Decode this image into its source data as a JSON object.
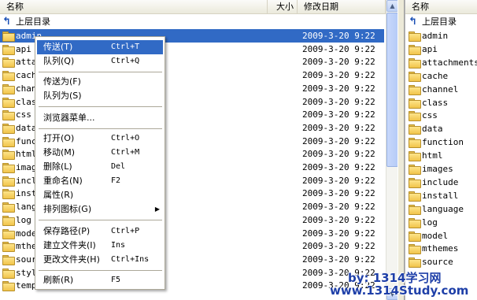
{
  "left": {
    "headers": {
      "name": "名称",
      "size": "大小",
      "modified": "修改日期"
    },
    "up_label": "上层目录",
    "rows": [
      {
        "name": "admin",
        "date": "2009-3-20  9:22"
      },
      {
        "name": "api",
        "date": "2009-3-20  9:22"
      },
      {
        "name": "attachments",
        "date": "2009-3-20  9:22"
      },
      {
        "name": "cache",
        "date": "2009-3-20  9:22"
      },
      {
        "name": "channel",
        "date": "2009-3-20  9:22"
      },
      {
        "name": "class",
        "date": "2009-3-20  9:22"
      },
      {
        "name": "css",
        "date": "2009-3-20  9:22"
      },
      {
        "name": "data",
        "date": "2009-3-20  9:22"
      },
      {
        "name": "function",
        "date": "2009-3-20  9:22"
      },
      {
        "name": "html",
        "date": "2009-3-20  9:22"
      },
      {
        "name": "images",
        "date": "2009-3-20  9:22"
      },
      {
        "name": "include",
        "date": "2009-3-20  9:22"
      },
      {
        "name": "install",
        "date": "2009-3-20  9:22"
      },
      {
        "name": "language",
        "date": "2009-3-20  9:22"
      },
      {
        "name": "log",
        "date": "2009-3-20  9:22"
      },
      {
        "name": "model",
        "date": "2009-3-20  9:22"
      },
      {
        "name": "mthemes",
        "date": "2009-3-20  9:22"
      },
      {
        "name": "source",
        "date": "2009-3-20  9:22"
      },
      {
        "name": "style",
        "date": "2009-3-20  9:22"
      },
      {
        "name": "templates",
        "date": "2009-3-20  9:22"
      }
    ]
  },
  "right": {
    "headers": {
      "name": "名称"
    },
    "up_label": "上层目录",
    "rows": [
      "admin",
      "api",
      "attachments",
      "cache",
      "channel",
      "class",
      "css",
      "data",
      "function",
      "html",
      "images",
      "include",
      "install",
      "language",
      "log",
      "model",
      "mthemes",
      "source"
    ]
  },
  "menu": {
    "transfer": {
      "label": "传送(T)",
      "shortcut": "Ctrl+T"
    },
    "queue": {
      "label": "队列(Q)",
      "shortcut": "Ctrl+Q"
    },
    "transfer_as": {
      "label": "传送为(F)"
    },
    "queue_as": {
      "label": "队列为(S)"
    },
    "browser_menu": {
      "label": "浏览器菜单..."
    },
    "open": {
      "label": "打开(O)",
      "shortcut": "Ctrl+O"
    },
    "move": {
      "label": "移动(M)",
      "shortcut": "Ctrl+M"
    },
    "delete": {
      "label": "删除(L)",
      "shortcut": "Del"
    },
    "rename": {
      "label": "重命名(N)",
      "shortcut": "F2"
    },
    "properties": {
      "label": "属性(R)"
    },
    "arrange_icons": {
      "label": "排列图标(G)"
    },
    "save_path": {
      "label": "保存路径(P)",
      "shortcut": "Ctrl+P"
    },
    "new_folder": {
      "label": "建立文件夹(I)",
      "shortcut": "Ins"
    },
    "change_folder": {
      "label": "更改文件夹(H)",
      "shortcut": "Ctrl+Ins"
    },
    "refresh": {
      "label": "刷新(R)",
      "shortcut": "F5"
    }
  },
  "watermark": {
    "line1": "by: 1314学习网",
    "line2": "www.1314Study.com"
  },
  "colors": {
    "selection": "#316ac5",
    "folder": "#f1c44a",
    "watermark": "#1e3fa8"
  }
}
